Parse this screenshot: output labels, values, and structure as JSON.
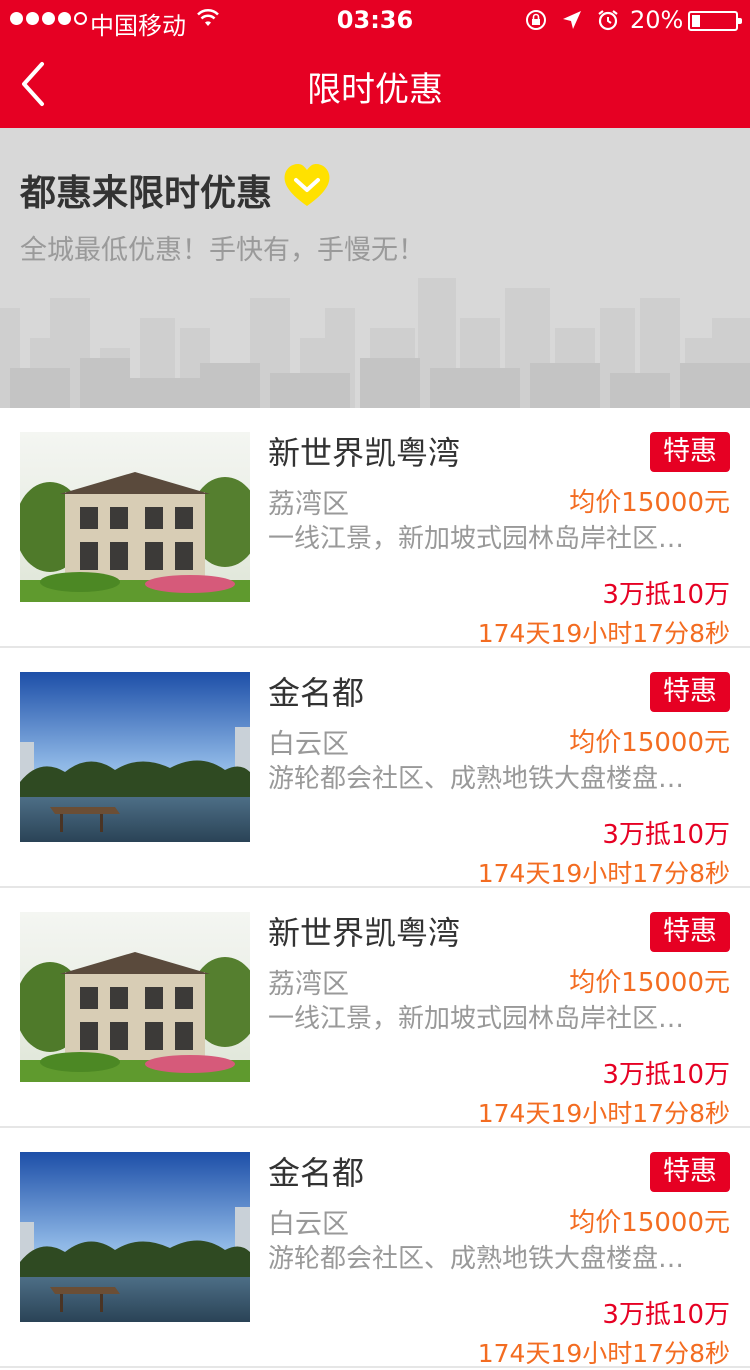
{
  "status_bar": {
    "carrier": "中国移动",
    "time": "03:36",
    "battery_percent": "20%",
    "battery_level": 0.2,
    "icons": [
      "wifi-icon",
      "rotation-lock-icon",
      "location-arrow-icon",
      "alarm-icon"
    ]
  },
  "navbar": {
    "title": "限时优惠",
    "back_icon": "chevron-left-icon"
  },
  "banner": {
    "headline": "都惠来限时优惠",
    "subtitle": "全城最低优惠！手快有，手慢无！",
    "heart_icon": "heart-icon",
    "heart_color": "#ffe100"
  },
  "colors": {
    "primary_red": "#e60023",
    "orange": "#f36c21",
    "banner_gray": "#d8d8d8"
  },
  "listings": [
    {
      "name": "新世界凯粤湾",
      "tag": "特惠",
      "district": "荔湾区",
      "price": "均价15000元",
      "description": "一线江景，新加坡式园林岛岸社区…",
      "deal": "3万抵10万",
      "countdown": "174天19小时17分8秒",
      "image": "villa-photo"
    },
    {
      "name": "金名都",
      "tag": "特惠",
      "district": "白云区",
      "price": "均价15000元",
      "description": "游轮都会社区、成熟地铁大盘楼盘…",
      "deal": "3万抵10万",
      "countdown": "174天19小时17分8秒",
      "image": "lake-photo"
    },
    {
      "name": "新世界凯粤湾",
      "tag": "特惠",
      "district": "荔湾区",
      "price": "均价15000元",
      "description": "一线江景，新加坡式园林岛岸社区…",
      "deal": "3万抵10万",
      "countdown": "174天19小时17分8秒",
      "image": "villa-photo"
    },
    {
      "name": "金名都",
      "tag": "特惠",
      "district": "白云区",
      "price": "均价15000元",
      "description": "游轮都会社区、成熟地铁大盘楼盘…",
      "deal": "3万抵10万",
      "countdown": "174天19小时17分8秒",
      "image": "lake-photo"
    }
  ]
}
